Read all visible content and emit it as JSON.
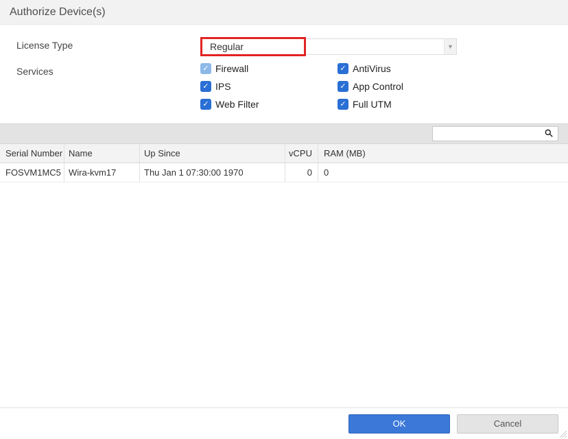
{
  "title": "Authorize Device(s)",
  "form": {
    "license_type_label": "License Type",
    "license_type_value": "Regular",
    "services_label": "Services",
    "services": [
      {
        "key": "firewall",
        "label": "Firewall",
        "checked": true,
        "disabled": true
      },
      {
        "key": "antivirus",
        "label": "AntiVirus",
        "checked": true,
        "disabled": false
      },
      {
        "key": "ips",
        "label": "IPS",
        "checked": true,
        "disabled": false
      },
      {
        "key": "appcontrol",
        "label": "App Control",
        "checked": true,
        "disabled": false
      },
      {
        "key": "webfilter",
        "label": "Web Filter",
        "checked": true,
        "disabled": false
      },
      {
        "key": "fullutm",
        "label": "Full UTM",
        "checked": true,
        "disabled": false
      }
    ]
  },
  "table": {
    "columns": {
      "serial": "Serial Number",
      "name": "Name",
      "since": "Up Since",
      "vcpu": "vCPU",
      "ram": "RAM (MB)"
    },
    "rows": [
      {
        "serial": "FOSVM1MC5",
        "name": "Wira-kvm17",
        "since": "Thu Jan 1 07:30:00 1970",
        "vcpu": "0",
        "ram": "0"
      }
    ],
    "search_placeholder": ""
  },
  "footer": {
    "ok": "OK",
    "cancel": "Cancel"
  },
  "icons": {
    "check": "✓",
    "caret": "▼"
  }
}
